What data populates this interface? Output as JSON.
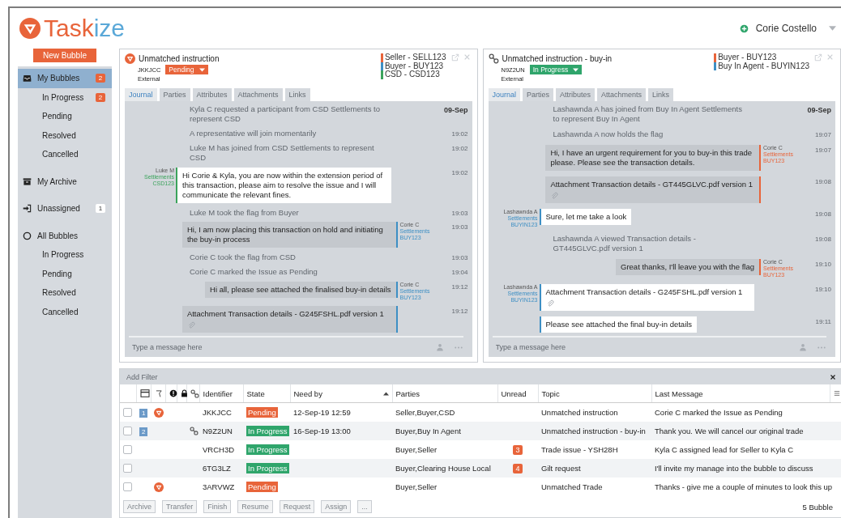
{
  "header": {
    "logo": [
      "Task",
      "ize"
    ],
    "user": "Corie Costello"
  },
  "sidebar": {
    "new_button": "New Bubble",
    "items": [
      {
        "label": "My Bubbles",
        "selected": true,
        "badge": {
          "text": "2",
          "color": "#e8643a"
        },
        "children": [
          {
            "label": "In Progress",
            "selected": false,
            "badge": {
              "text": "2",
              "color": "#e8643a"
            }
          },
          {
            "label": "Pending",
            "selected": false
          },
          {
            "label": "Resolved",
            "selected": false
          },
          {
            "label": "Cancelled",
            "selected": false
          }
        ]
      },
      {
        "label": "My Archive",
        "selected": false
      },
      {
        "label": "Unassigned",
        "selected": false,
        "badge": {
          "text": "1",
          "color": "#ffffff"
        }
      },
      {
        "label": "All Bubbles",
        "selected": false,
        "children": [
          {
            "label": "In Progress",
            "selected": false
          },
          {
            "label": "Pending",
            "selected": false
          },
          {
            "label": "Resolved",
            "selected": false
          },
          {
            "label": "Cancelled",
            "selected": false
          }
        ]
      }
    ]
  },
  "panels": [
    {
      "kind": "flagged",
      "title": "Unmatched instruction",
      "identifier": "JKKJCC",
      "status": {
        "label": "Pending",
        "color": "#e8643a"
      },
      "origin": "External",
      "parties": [
        {
          "label": "Seller - SELL123",
          "color": "#e8643a"
        },
        {
          "label": "Buyer - BUY123",
          "color": "#3d8fc4"
        },
        {
          "label": "CSD - CSD123",
          "color": "#3aa35b"
        }
      ],
      "tabs": [
        {
          "label": "Journal",
          "selected": true
        },
        {
          "label": "Parties",
          "selected": false
        },
        {
          "label": "Attributes",
          "selected": false
        },
        {
          "label": "Attachments",
          "selected": false
        },
        {
          "label": "Links",
          "selected": false
        }
      ],
      "messages": [
        {
          "kind": "event",
          "text": "Kyla C requested a participant from CSD Settlements to represent CSD",
          "date": "09-Sep"
        },
        {
          "kind": "event",
          "text": "A representative will join momentarily",
          "time": "19:02"
        },
        {
          "kind": "event",
          "text": "Luke M has joined from CSD Settlements to represent CSD",
          "time": "19:02"
        },
        {
          "kind": "message",
          "outgoing": false,
          "text": "Hi Corie & Kyla, you are now within the extension period of this transaction, please aim to resolve the issue and I will communicate the relevant fines.",
          "time": "19:02",
          "color": "#3aa35b",
          "author": {
            "name": "Luke M",
            "team": "Settlements",
            "code": "CSD123"
          }
        },
        {
          "kind": "event",
          "text": "Luke M took the flag from Buyer",
          "time": "19:03"
        },
        {
          "kind": "message",
          "outgoing": true,
          "text": "Hi, I am now placing this transaction on hold and initiating the buy-in process",
          "time": "19:03",
          "color": "#3d8fc4",
          "author": {
            "name": "Corie C",
            "team": "Settlements",
            "code": "BUY123"
          }
        },
        {
          "kind": "event",
          "text": "Corie C took the flag from CSD",
          "time": "19:03"
        },
        {
          "kind": "event",
          "text": "Corie C marked the Issue as Pending",
          "time": "19:04"
        },
        {
          "kind": "message",
          "outgoing": true,
          "text": "Hi all, please see attached the finalised buy-in details",
          "time": "19:12",
          "color": "#3d8fc4",
          "author": {
            "name": "Corie C",
            "team": "Settlements",
            "code": "BUY123"
          }
        },
        {
          "kind": "message",
          "outgoing": true,
          "text": "Attachment Transaction details - G245FSHL.pdf version 1",
          "time": "19:12",
          "color": "#3d8fc4",
          "attachment": true
        }
      ],
      "placeholder": "Type a message here"
    },
    {
      "kind": "linked",
      "title": "Unmatched instruction - buy-in",
      "identifier": "N9Z2UN",
      "status": {
        "label": "In Progress",
        "color": "#2fa56b"
      },
      "origin": "External",
      "parties": [
        {
          "label": "Buyer - BUY123",
          "color": "#e8643a"
        },
        {
          "label": "Buy In Agent - BUYIN123",
          "color": "#3d8fc4"
        }
      ],
      "tabs": [
        {
          "label": "Journal",
          "selected": true
        },
        {
          "label": "Parties",
          "selected": false
        },
        {
          "label": "Attributes",
          "selected": false
        },
        {
          "label": "Attachments",
          "selected": false
        },
        {
          "label": "Links",
          "selected": false
        }
      ],
      "messages": [
        {
          "kind": "event",
          "text": "Lashawnda A has joined from Buy In Agent Settlements to represent Buy In Agent",
          "date": "09-Sep"
        },
        {
          "kind": "event",
          "text": "Lashawnda A now holds the flag",
          "time": "19:07"
        },
        {
          "kind": "message",
          "outgoing": true,
          "text": "Hi, I have an urgent requirement for you to buy-in this trade please. Please see the transaction details.",
          "time": "19:07",
          "color": "#e8643a",
          "author": {
            "name": "Corie C",
            "team": "Settlements",
            "code": "BUY123"
          }
        },
        {
          "kind": "message",
          "outgoing": true,
          "text": "Attachment Transaction details - GT445GLVC.pdf version 1",
          "time": "19:08",
          "color": "#e8643a",
          "attachment": true
        },
        {
          "kind": "message",
          "outgoing": false,
          "text": "Sure, let me take a look",
          "time": "19:08",
          "color": "#3d8fc4",
          "author": {
            "name": "Lashawnda A",
            "team": "Settlements",
            "code": "BUYIN123"
          }
        },
        {
          "kind": "event",
          "text": "Lashawnda A viewed Transaction details - GT445GLVC.pdf version 1",
          "time": "19:08"
        },
        {
          "kind": "message",
          "outgoing": true,
          "text": "Great thanks, I'll leave you with the flag",
          "time": "19:10",
          "color": "#e8643a",
          "author": {
            "name": "Corie C",
            "team": "Settlements",
            "code": "BUY123"
          }
        },
        {
          "kind": "message",
          "outgoing": false,
          "text": "Attachment Transaction details - G245FSHL.pdf version 1",
          "time": "19:10",
          "color": "#3d8fc4",
          "attachment": true,
          "author": {
            "name": "Lashawnda A",
            "team": "Settlements",
            "code": "BUYIN123"
          }
        },
        {
          "kind": "message",
          "outgoing": false,
          "text": "Please see attached the final buy-in details",
          "time": "19:11",
          "color": "#3d8fc4"
        }
      ],
      "placeholder": "Type a message here"
    }
  ],
  "filter": {
    "placeholder": "Add Filter"
  },
  "table": {
    "columns": [
      {
        "label": "Identifier",
        "sorted": false
      },
      {
        "label": "State",
        "sorted": false
      },
      {
        "label": "Need by",
        "sorted": true
      },
      {
        "label": "Parties",
        "sorted": false
      },
      {
        "label": "Unread",
        "sorted": false
      },
      {
        "label": "Topic",
        "sorted": false
      },
      {
        "label": "Last Message",
        "sorted": false
      }
    ],
    "rows": [
      {
        "checked": false,
        "number": "1",
        "flagged": true,
        "linked": false,
        "identifier": "JKKJCC",
        "state": {
          "label": "Pending",
          "color": "#e8643a"
        },
        "need_by": "12-Sep-19 12:59",
        "parties": "Seller,Buyer,CSD",
        "topic": "Unmatched instruction",
        "last_message": "Corie C marked the Issue as Pending"
      },
      {
        "checked": false,
        "number": "2",
        "flagged": false,
        "linked": true,
        "identifier": "N9Z2UN",
        "state": {
          "label": "In Progress",
          "color": "#2fa56b"
        },
        "need_by": "16-Sep-19 13:00",
        "parties": "Buyer,Buy In Agent",
        "topic": "Unmatched instruction - buy-in",
        "last_message": "Thank you. We will cancel our original trade"
      },
      {
        "checked": false,
        "flagged": false,
        "linked": false,
        "identifier": "VRCH3D",
        "state": {
          "label": "In Progress",
          "color": "#2fa56b"
        },
        "parties": "Buyer,Seller",
        "unread": "3",
        "topic": "Trade issue - YSH28H",
        "last_message": "Kyla C assigned lead for Seller to Kyla C"
      },
      {
        "checked": false,
        "flagged": false,
        "linked": false,
        "identifier": "6TG3LZ",
        "state": {
          "label": "In Progress",
          "color": "#2fa56b"
        },
        "parties": "Buyer,Clearing House Local",
        "unread": "4",
        "topic": "Gilt request",
        "last_message": "I'll invite my manage into the bubble to discuss"
      },
      {
        "checked": false,
        "flagged": true,
        "linked": false,
        "identifier": "3ARVWZ",
        "state": {
          "label": "Pending",
          "color": "#e8643a"
        },
        "parties": "Buyer,Seller",
        "topic": "Unmatched Trade",
        "last_message": "Thanks - give me a couple of minutes to look this up"
      }
    ]
  },
  "actions": [
    {
      "label": "Archive",
      "disabled": true
    },
    {
      "label": "Transfer",
      "disabled": true
    },
    {
      "label": "Finish",
      "disabled": true
    },
    {
      "label": "Resume",
      "disabled": true
    },
    {
      "label": "Request",
      "disabled": true
    },
    {
      "label": "Assign",
      "disabled": true
    },
    {
      "label": "...",
      "disabled": true
    }
  ],
  "count": "5 Bubble"
}
